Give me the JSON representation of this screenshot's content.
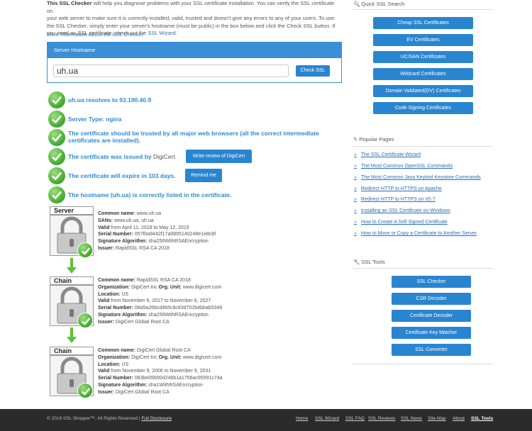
{
  "intro": {
    "line1_prefix": "This SSL Checker",
    "line1_rest": " will help you diagnose problems with your SSL certificate installation. You can verify the SSL certificate on",
    "line2": "your web server to make sure it is correctly installed, valid, trusted and doesn't give any errors to any of your users. To use",
    "line3": "the SSL Checker, simply enter your server's hostname (must be public) in the box below and click the Check SSL button. If",
    "line4_prefix": "you need an SSL certificate, check out the ",
    "line4_link": "SSL Wizard",
    "line4_suffix": ".",
    "more_link": "More Information About the SSL Checker"
  },
  "hostname_panel": {
    "title": "Server Hostname",
    "input_value": "uh.ua",
    "check_button": "Check SSL"
  },
  "results": [
    {
      "text": "uh.ua resolves to 93.190.40.9"
    },
    {
      "text": "Server Type: nginx"
    },
    {
      "text": "The certificate should be trusted by all major web browsers (all the correct intermediate certificates are installed)."
    },
    {
      "text": "The certificate was issued by ",
      "issuer": "DigiCert",
      "suffix": ".",
      "button": "Write review of DigiCert"
    },
    {
      "text": "The certificate will expire in 103 days.",
      "button": "Remind me"
    },
    {
      "text": "The hostname (uh.ua) is correctly listed in the certificate."
    }
  ],
  "chain": [
    {
      "label": "Server",
      "fields": [
        {
          "k": "Common name:",
          "v": " www.uh.ua"
        },
        {
          "k": "SANs:",
          "v": " www.uh.ua, uh.ua"
        },
        {
          "k": "Valid",
          "v": " from April 11, 2018 to May 12, 2019"
        },
        {
          "k": "Serial Number:",
          "v": " 057f0a9442f17a0895140248e1e8cbf"
        },
        {
          "k": "Signature Algorithm:",
          "v": " sha256WithRSAEncryption"
        },
        {
          "k": "Issuer:",
          "v": " RapidSSL RSA CA 2018"
        }
      ]
    },
    {
      "label": "Chain",
      "fields": [
        {
          "k": "Common name:",
          "v": " RapidSSL RSA CA 2018"
        },
        {
          "k": "Organization:",
          "v": " DigiCert Inc ",
          "k2": "Org. Unit:",
          "v2": " www.digicert.com"
        },
        {
          "k": "Location:",
          "v": " US"
        },
        {
          "k": "Valid",
          "v": " from November 6, 2017 to November 6, 2027"
        },
        {
          "k": "Serial Number:",
          "v": " 08a5a266cd4b5c8c83d702b4bbab5349"
        },
        {
          "k": "Signature Algorithm:",
          "v": " sha256WithRSAEncryption"
        },
        {
          "k": "Issuer:",
          "v": " DigiCert Global Root CA"
        }
      ]
    },
    {
      "label": "Chain",
      "fields": [
        {
          "k": "Common name:",
          "v": " DigiCert Global Root CA"
        },
        {
          "k": "Organization:",
          "v": " DigiCert Inc ",
          "k2": "Org. Unit:",
          "v2": " www.digicert.com"
        },
        {
          "k": "Location:",
          "v": " US"
        },
        {
          "k": "Valid",
          "v": " from November 9, 2006 to November 9, 2031"
        },
        {
          "k": "Serial Number:",
          "v": " 083be056904246b1a1756ac95991c74a"
        },
        {
          "k": "Signature Algorithm:",
          "v": " sha1WithRSAEncryption"
        },
        {
          "k": "Issuer:",
          "v": " DigiCert Global Root CA"
        }
      ]
    }
  ],
  "sidebar": {
    "quick_search_title": "Quick SSL Search",
    "quick_search_buttons": [
      "Cheap SSL Certificates",
      "EV Certificates",
      "UC/SAN Certificates",
      "Wildcard Certificates",
      "Domain Validated(DV) Certificates",
      "Code Signing Certificates"
    ],
    "popular_title": "Popular Pages",
    "popular_items": [
      "The SSL Certificate Wizard",
      "The Most Common OpenSSL Commands",
      "The Most Common Java Keytool Keystore Commands",
      "Redirect HTTP to HTTPS on Apache",
      "Redirect HTTP to HTTPS on IIS 7",
      "Installing an SSL Certificate on Windows",
      "How to Create A Self Signed Certificate",
      "How to Move or Copy a Certificate to Another Server"
    ],
    "tools_title": "SSL Tools",
    "tools_buttons": [
      "SSL Checker",
      "CSR Decoder",
      "Certificate Decoder",
      "Certificate Key Matcher",
      "SSL Converter"
    ]
  },
  "footer": {
    "copyright": "© 2019 SSL Shopper™. All Rights Reserved |",
    "disclosure": "Full Disclosure",
    "nav": [
      "Home",
      "SSL Wizard",
      "SSL FAQ",
      "SSL Reviews",
      "SSL News",
      "Site Map",
      "About",
      "SSL Tools"
    ]
  },
  "colors": {
    "accent": "#2a85d0",
    "check_green": "#3fa82e",
    "footer_bg": "#2b2b2b"
  }
}
